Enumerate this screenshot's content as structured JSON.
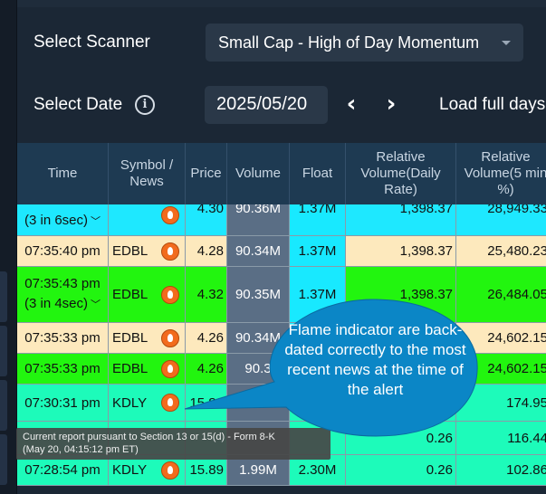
{
  "controls": {
    "scanner_label": "Select Scanner",
    "scanner_value": "Small Cap - High of Day Momentum",
    "date_label": "Select Date",
    "date_value": "2025/05/20",
    "prev_icon": "chevron-left-icon",
    "next_icon": "chevron-right-icon",
    "load_label": "Load full days"
  },
  "table": {
    "headers": [
      "Time",
      "Symbol / News",
      "Price",
      "Volume",
      "Float",
      "Relative Volume(Daily Rate)",
      "Relative Volume(5 min %)"
    ],
    "rows": [
      {
        "time": "(3 in 6sec)",
        "time_sub": "",
        "symbol": "EDBL",
        "price": "4.30",
        "volume": "90.36M",
        "float": "1.37M",
        "rv_daily": "1,398.37",
        "rv_5min": "28,949.33",
        "color": "#1ee8ff"
      },
      {
        "time": "07:35:40 pm",
        "time_sub": "",
        "symbol": "EDBL",
        "price": "4.28",
        "volume": "90.34M",
        "float": "1.37M",
        "rv_daily": "1,398.37",
        "rv_5min": "25,480.23",
        "color": "#fde9bd"
      },
      {
        "time": "07:35:43 pm",
        "time_sub": "(3 in 4sec)",
        "symbol": "EDBL",
        "price": "4.32",
        "volume": "90.35M",
        "float": "1.37M",
        "rv_daily": "1,398.37",
        "rv_5min": "26,484.05",
        "color": "#22f50f"
      },
      {
        "time": "07:35:33 pm",
        "time_sub": "",
        "symbol": "EDBL",
        "price": "4.26",
        "volume": "90.34M",
        "float": "1.37M",
        "rv_daily": "",
        "rv_5min": "24,602.15",
        "color": "#fde9bd"
      },
      {
        "time": "07:35:33 pm",
        "time_sub": "",
        "symbol": "EDBL",
        "price": "4.26",
        "volume": "90.3",
        "float": "",
        "rv_daily": "",
        "rv_5min": "24,602.15",
        "color": "#22f50f"
      },
      {
        "time": "07:30:31 pm",
        "time_sub": "",
        "symbol": "KDLY",
        "price": "15.89",
        "volume": "2.",
        "float": "",
        "rv_daily": "",
        "rv_5min": "174.95",
        "color": "#1dfbba"
      },
      {
        "time": "",
        "time_sub": "",
        "symbol": "",
        "price": "",
        "volume": "",
        "float": "",
        "rv_daily": "0.26",
        "rv_5min": "116.44",
        "color": "#1dfbba"
      },
      {
        "time": "07:28:54 pm",
        "time_sub": "",
        "symbol": "KDLY",
        "price": "15.89",
        "volume": "1.99M",
        "float": "2.30M",
        "rv_daily": "0.26",
        "rv_5min": "102.86",
        "color": "#1dfbba"
      }
    ]
  },
  "tooltip": {
    "line1": "Current report pursuant to Section 13 or 15(d) - Form 8-K",
    "line2": "(May 20, 04:15:12 pm ET)"
  },
  "callout": {
    "text": "Flame indicator are back-dated correctly to the most recent news at the time of the alert"
  }
}
